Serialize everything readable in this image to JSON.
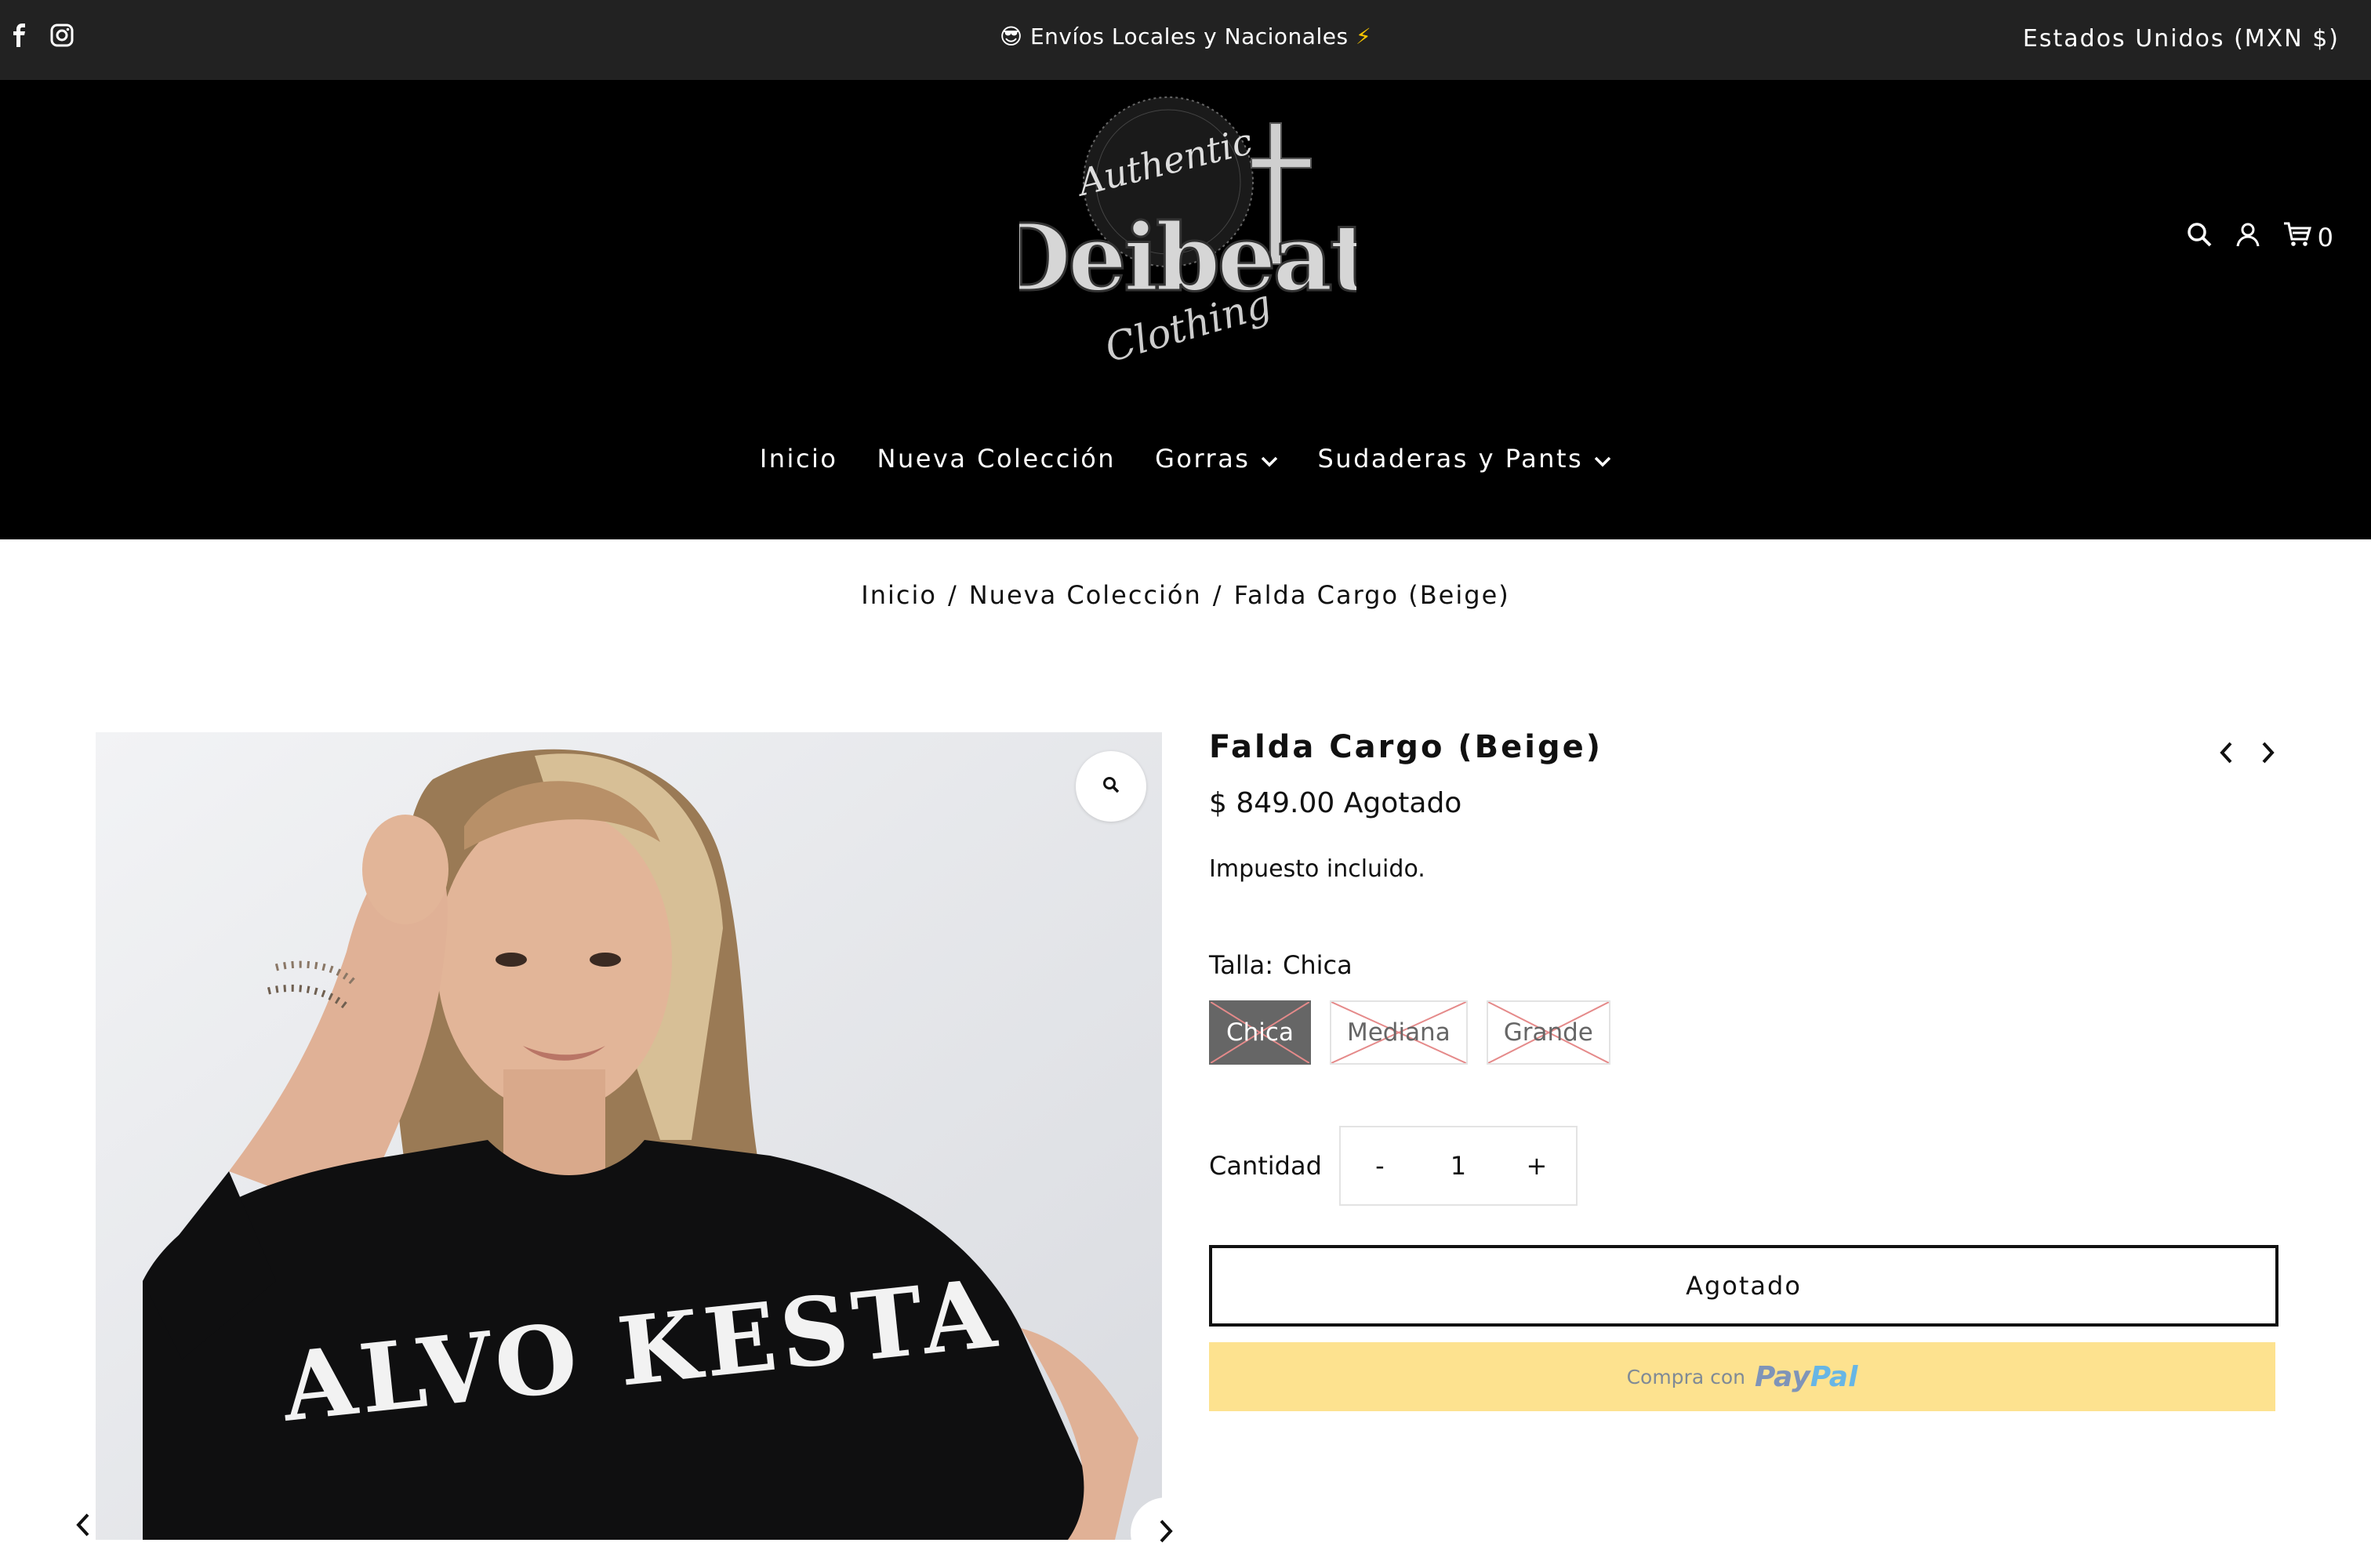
{
  "topbar": {
    "announcement_emoji": "😎",
    "announcement": "Envíos Locales y Nacionales",
    "announcement_suffix": "⚡",
    "currency": "Estados Unidos (MXN $)"
  },
  "logo": {
    "line1": "Authentic",
    "line2": "Deibeat",
    "line3": "Clothing"
  },
  "header": {
    "cart_count": "0"
  },
  "nav": {
    "items": [
      {
        "label": "Inicio"
      },
      {
        "label": "Nueva Colección"
      },
      {
        "label": "Gorras"
      },
      {
        "label": "Sudaderas y Pants"
      }
    ]
  },
  "breadcrumb": {
    "home": "Inicio",
    "collection": "Nueva Colección",
    "current": "Falda Cargo (Beige)",
    "separator": "/"
  },
  "gallery": {
    "shirt_text": "ALVO KESTA"
  },
  "product": {
    "title": "Falda Cargo (Beige)",
    "price": "$ 849.00",
    "status": "Agotado",
    "tax_note": "Impuesto incluido.",
    "size_label": "Talla:",
    "size_selected": "Chica",
    "sizes": [
      {
        "label": "Chica"
      },
      {
        "label": "Mediana"
      },
      {
        "label": "Grande"
      }
    ],
    "quantity_label": "Cantidad",
    "quantity_minus": "-",
    "quantity_value": "1",
    "quantity_plus": "+",
    "soldout_button": "Agotado",
    "paypal_prefix": "Compra con",
    "paypal_brand_a": "Pay",
    "paypal_brand_b": "Pal"
  },
  "colors": {
    "topbar_bg": "#222222",
    "header_bg": "#000000",
    "selected_size_bg": "#666666",
    "paypal_bg": "#fde28f",
    "cross_red": "#e58a8a"
  }
}
